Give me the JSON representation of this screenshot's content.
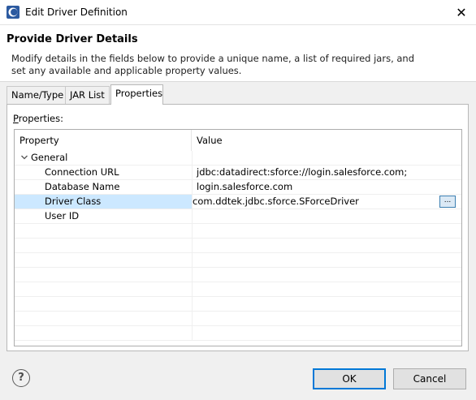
{
  "window": {
    "title": "Edit Driver Definition",
    "close_symbol": "✕"
  },
  "header": {
    "title": "Provide Driver Details",
    "description": "Modify details in the fields below to provide a unique name, a list of required jars, and set any available and applicable property values."
  },
  "tabs": [
    {
      "label": "Name/Type",
      "active": false
    },
    {
      "label": "JAR List",
      "active": false
    },
    {
      "label": "Properties",
      "active": true
    }
  ],
  "properties_panel": {
    "label_underlined": "P",
    "label_rest": "roperties:",
    "columns": [
      "Property",
      "Value"
    ],
    "group": {
      "name": "General",
      "expanded": true,
      "icon": "chevron-down-icon"
    },
    "rows": [
      {
        "property": "Connection URL",
        "value": "jdbc:datadirect:sforce://login.salesforce.com;"
      },
      {
        "property": "Database Name",
        "value": "login.salesforce.com"
      },
      {
        "property": "Driver Class",
        "value": "com.ddtek.jdbc.sforce.SForceDriver",
        "selected": true
      },
      {
        "property": "User ID",
        "value": ""
      }
    ],
    "ellipsis_label": "..."
  },
  "footer": {
    "help_symbol": "?",
    "ok_label": "OK",
    "cancel_label": "Cancel"
  }
}
